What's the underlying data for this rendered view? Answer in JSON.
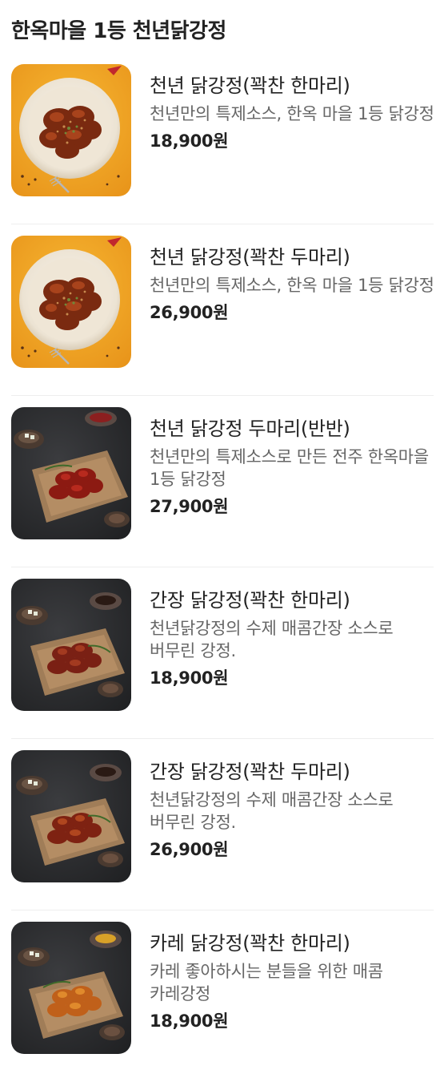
{
  "section": {
    "title": "한옥마을 1등 천년닭강정"
  },
  "menu": {
    "items": [
      {
        "name": "천년 닭강정(꽉찬 한마리)",
        "description": "천년만의 특제소스, 한옥 마을 1등 닭강정",
        "price": "18,900원",
        "image": "sweet-red-chicken-photo-orange"
      },
      {
        "name": "천년 닭강정(꽉찬 두마리)",
        "description": "천년만의 특제소스, 한옥 마을 1등 닭강정",
        "price": "26,900원",
        "image": "sweet-red-chicken-photo-orange"
      },
      {
        "name": "천년 닭강정 두마리(반반)",
        "description": "천년만의 특제소스로 만든 전주 한옥마을 1등 닭강정",
        "price": "27,900원",
        "image": "half-half-chicken-photo-dark"
      },
      {
        "name": "간장 닭강정(꽉찬 한마리)",
        "description": "천년닭강정의 수제 매콤간장 소스로 버무린 강정.",
        "price": "18,900원",
        "image": "soy-chicken-photo-dark"
      },
      {
        "name": "간장 닭강정(꽉찬 두마리)",
        "description": "천년닭강정의 수제 매콤간장 소스로 버무린 강정.",
        "price": "26,900원",
        "image": "soy-chicken-photo-dark"
      },
      {
        "name": "카레 닭강정(꽉찬 한마리)",
        "description": "카레 좋아하시는 분들을 위한 매콤 카레강정",
        "price": "18,900원",
        "image": "curry-chicken-photo-dark"
      }
    ]
  },
  "colors": {
    "title_text": "#222222",
    "description_text": "#666666",
    "divider": "#eeeeee",
    "orange_background": "#f2a823",
    "dark_background": "#2e2f31"
  }
}
